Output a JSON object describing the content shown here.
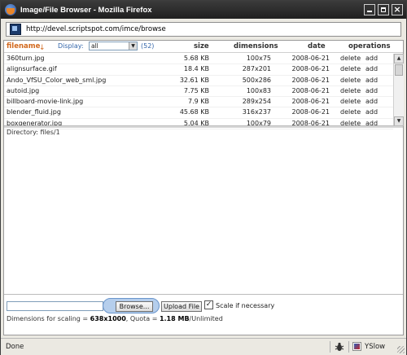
{
  "window": {
    "title": "Image/File Browser - Mozilla Firefox"
  },
  "address": {
    "url": "http://devel.scriptspot.com/imce/browse"
  },
  "table": {
    "columns": {
      "filename": "filename",
      "size": "size",
      "dimensions": "dimensions",
      "date": "date",
      "operations": "operations"
    },
    "sort_arrow": "↓",
    "display_label": "Display:",
    "display_value": "all",
    "count": "(52)",
    "rows": [
      {
        "name": "360turn.jpg",
        "size": "5.68 KB",
        "dimensions": "100x75",
        "date": "2008-06-21",
        "delete": "delete",
        "add": "add"
      },
      {
        "name": "alignsurface.gif",
        "size": "18.4 KB",
        "dimensions": "287x201",
        "date": "2008-06-21",
        "delete": "delete",
        "add": "add"
      },
      {
        "name": "Ando_VfSU_Color_web_sml.jpg",
        "size": "32.61 KB",
        "dimensions": "500x286",
        "date": "2008-06-21",
        "delete": "delete",
        "add": "add"
      },
      {
        "name": "autoid.jpg",
        "size": "7.75 KB",
        "dimensions": "100x83",
        "date": "2008-06-21",
        "delete": "delete",
        "add": "add"
      },
      {
        "name": "billboard-movie-link.jpg",
        "size": "7.9 KB",
        "dimensions": "289x254",
        "date": "2008-06-21",
        "delete": "delete",
        "add": "add"
      },
      {
        "name": "blender_fluid.jpg",
        "size": "45.68 KB",
        "dimensions": "316x237",
        "date": "2008-06-21",
        "delete": "delete",
        "add": "add"
      },
      {
        "name": "boxgenerator.jpg",
        "size": "5.04 KB",
        "dimensions": "100x79",
        "date": "2008-06-21",
        "delete": "delete",
        "add": "add"
      }
    ]
  },
  "directory": "Directory: files/1",
  "upload": {
    "browse_label": "Browse...",
    "upload_label": "Upload File",
    "scale_label": "Scale if necessary",
    "scale_checked": "✓",
    "dims_prefix": "Dimensions for scaling = ",
    "dims_value": "638x1000",
    "quota_prefix": ", Quota = ",
    "quota_value": "1.18 MB",
    "quota_suffix": "/Unlimited"
  },
  "status": {
    "text": "Done",
    "yslow": "YSlow"
  },
  "icons": {
    "window": "firefox-icon",
    "site": "site-favicon",
    "status1": "bug-icon",
    "status2": "yslow-icon"
  }
}
